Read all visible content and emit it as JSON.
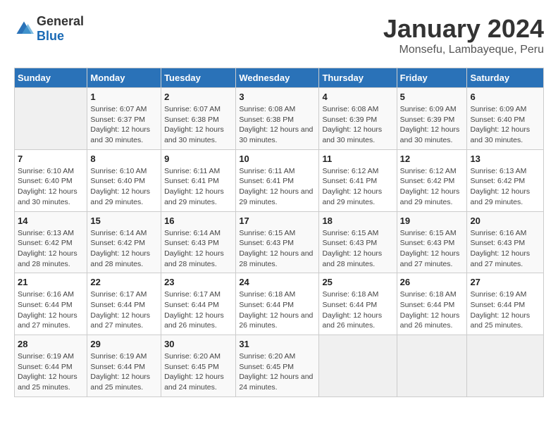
{
  "logo": {
    "general": "General",
    "blue": "Blue"
  },
  "title": "January 2024",
  "subtitle": "Monsefu, Lambayeque, Peru",
  "days_of_week": [
    "Sunday",
    "Monday",
    "Tuesday",
    "Wednesday",
    "Thursday",
    "Friday",
    "Saturday"
  ],
  "weeks": [
    [
      {
        "day": "",
        "sunrise": "",
        "sunset": "",
        "daylight": "",
        "empty": true
      },
      {
        "day": "1",
        "sunrise": "Sunrise: 6:07 AM",
        "sunset": "Sunset: 6:37 PM",
        "daylight": "Daylight: 12 hours and 30 minutes."
      },
      {
        "day": "2",
        "sunrise": "Sunrise: 6:07 AM",
        "sunset": "Sunset: 6:38 PM",
        "daylight": "Daylight: 12 hours and 30 minutes."
      },
      {
        "day": "3",
        "sunrise": "Sunrise: 6:08 AM",
        "sunset": "Sunset: 6:38 PM",
        "daylight": "Daylight: 12 hours and 30 minutes."
      },
      {
        "day": "4",
        "sunrise": "Sunrise: 6:08 AM",
        "sunset": "Sunset: 6:39 PM",
        "daylight": "Daylight: 12 hours and 30 minutes."
      },
      {
        "day": "5",
        "sunrise": "Sunrise: 6:09 AM",
        "sunset": "Sunset: 6:39 PM",
        "daylight": "Daylight: 12 hours and 30 minutes."
      },
      {
        "day": "6",
        "sunrise": "Sunrise: 6:09 AM",
        "sunset": "Sunset: 6:40 PM",
        "daylight": "Daylight: 12 hours and 30 minutes."
      }
    ],
    [
      {
        "day": "7",
        "sunrise": "Sunrise: 6:10 AM",
        "sunset": "Sunset: 6:40 PM",
        "daylight": "Daylight: 12 hours and 30 minutes."
      },
      {
        "day": "8",
        "sunrise": "Sunrise: 6:10 AM",
        "sunset": "Sunset: 6:40 PM",
        "daylight": "Daylight: 12 hours and 29 minutes."
      },
      {
        "day": "9",
        "sunrise": "Sunrise: 6:11 AM",
        "sunset": "Sunset: 6:41 PM",
        "daylight": "Daylight: 12 hours and 29 minutes."
      },
      {
        "day": "10",
        "sunrise": "Sunrise: 6:11 AM",
        "sunset": "Sunset: 6:41 PM",
        "daylight": "Daylight: 12 hours and 29 minutes."
      },
      {
        "day": "11",
        "sunrise": "Sunrise: 6:12 AM",
        "sunset": "Sunset: 6:41 PM",
        "daylight": "Daylight: 12 hours and 29 minutes."
      },
      {
        "day": "12",
        "sunrise": "Sunrise: 6:12 AM",
        "sunset": "Sunset: 6:42 PM",
        "daylight": "Daylight: 12 hours and 29 minutes."
      },
      {
        "day": "13",
        "sunrise": "Sunrise: 6:13 AM",
        "sunset": "Sunset: 6:42 PM",
        "daylight": "Daylight: 12 hours and 29 minutes."
      }
    ],
    [
      {
        "day": "14",
        "sunrise": "Sunrise: 6:13 AM",
        "sunset": "Sunset: 6:42 PM",
        "daylight": "Daylight: 12 hours and 28 minutes."
      },
      {
        "day": "15",
        "sunrise": "Sunrise: 6:14 AM",
        "sunset": "Sunset: 6:42 PM",
        "daylight": "Daylight: 12 hours and 28 minutes."
      },
      {
        "day": "16",
        "sunrise": "Sunrise: 6:14 AM",
        "sunset": "Sunset: 6:43 PM",
        "daylight": "Daylight: 12 hours and 28 minutes."
      },
      {
        "day": "17",
        "sunrise": "Sunrise: 6:15 AM",
        "sunset": "Sunset: 6:43 PM",
        "daylight": "Daylight: 12 hours and 28 minutes."
      },
      {
        "day": "18",
        "sunrise": "Sunrise: 6:15 AM",
        "sunset": "Sunset: 6:43 PM",
        "daylight": "Daylight: 12 hours and 28 minutes."
      },
      {
        "day": "19",
        "sunrise": "Sunrise: 6:15 AM",
        "sunset": "Sunset: 6:43 PM",
        "daylight": "Daylight: 12 hours and 27 minutes."
      },
      {
        "day": "20",
        "sunrise": "Sunrise: 6:16 AM",
        "sunset": "Sunset: 6:43 PM",
        "daylight": "Daylight: 12 hours and 27 minutes."
      }
    ],
    [
      {
        "day": "21",
        "sunrise": "Sunrise: 6:16 AM",
        "sunset": "Sunset: 6:44 PM",
        "daylight": "Daylight: 12 hours and 27 minutes."
      },
      {
        "day": "22",
        "sunrise": "Sunrise: 6:17 AM",
        "sunset": "Sunset: 6:44 PM",
        "daylight": "Daylight: 12 hours and 27 minutes."
      },
      {
        "day": "23",
        "sunrise": "Sunrise: 6:17 AM",
        "sunset": "Sunset: 6:44 PM",
        "daylight": "Daylight: 12 hours and 26 minutes."
      },
      {
        "day": "24",
        "sunrise": "Sunrise: 6:18 AM",
        "sunset": "Sunset: 6:44 PM",
        "daylight": "Daylight: 12 hours and 26 minutes."
      },
      {
        "day": "25",
        "sunrise": "Sunrise: 6:18 AM",
        "sunset": "Sunset: 6:44 PM",
        "daylight": "Daylight: 12 hours and 26 minutes."
      },
      {
        "day": "26",
        "sunrise": "Sunrise: 6:18 AM",
        "sunset": "Sunset: 6:44 PM",
        "daylight": "Daylight: 12 hours and 26 minutes."
      },
      {
        "day": "27",
        "sunrise": "Sunrise: 6:19 AM",
        "sunset": "Sunset: 6:44 PM",
        "daylight": "Daylight: 12 hours and 25 minutes."
      }
    ],
    [
      {
        "day": "28",
        "sunrise": "Sunrise: 6:19 AM",
        "sunset": "Sunset: 6:44 PM",
        "daylight": "Daylight: 12 hours and 25 minutes."
      },
      {
        "day": "29",
        "sunrise": "Sunrise: 6:19 AM",
        "sunset": "Sunset: 6:44 PM",
        "daylight": "Daylight: 12 hours and 25 minutes."
      },
      {
        "day": "30",
        "sunrise": "Sunrise: 6:20 AM",
        "sunset": "Sunset: 6:45 PM",
        "daylight": "Daylight: 12 hours and 24 minutes."
      },
      {
        "day": "31",
        "sunrise": "Sunrise: 6:20 AM",
        "sunset": "Sunset: 6:45 PM",
        "daylight": "Daylight: 12 hours and 24 minutes."
      },
      {
        "day": "",
        "sunrise": "",
        "sunset": "",
        "daylight": "",
        "empty": true
      },
      {
        "day": "",
        "sunrise": "",
        "sunset": "",
        "daylight": "",
        "empty": true
      },
      {
        "day": "",
        "sunrise": "",
        "sunset": "",
        "daylight": "",
        "empty": true
      }
    ]
  ]
}
